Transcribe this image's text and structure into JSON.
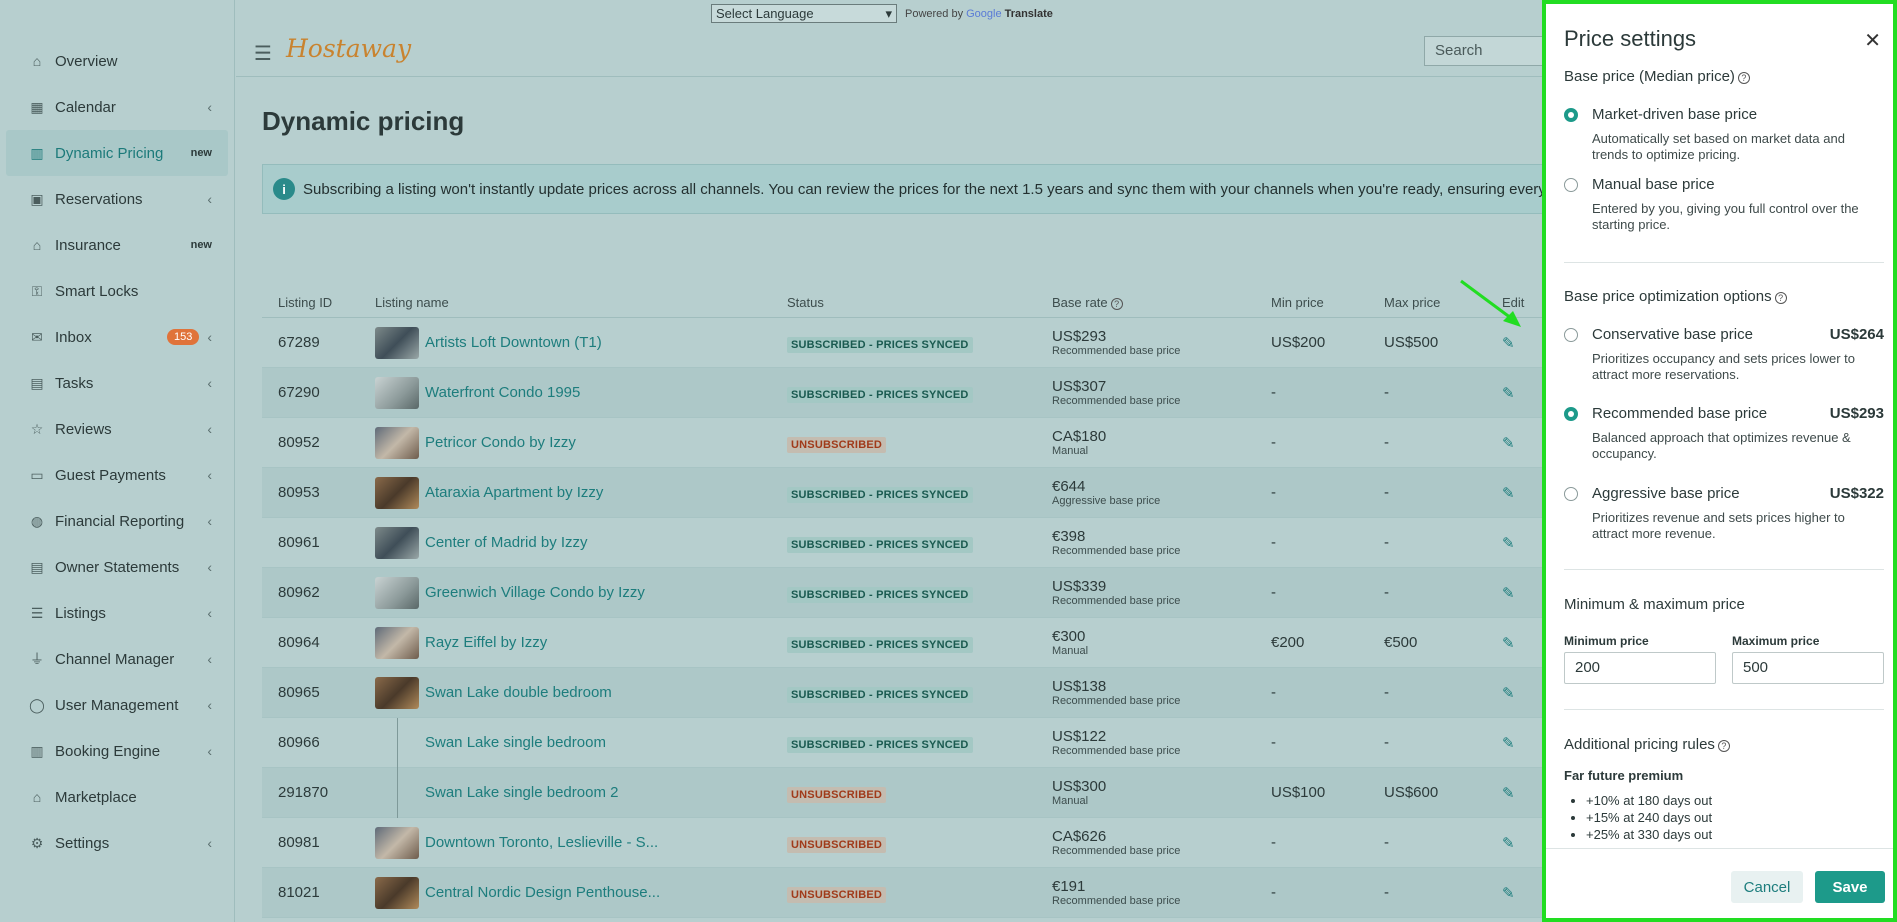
{
  "sidebar": {
    "items": [
      {
        "label": "Overview",
        "icon": "home-icon",
        "badge": "",
        "chevron": false
      },
      {
        "label": "Calendar",
        "icon": "calendar-icon",
        "badge": "",
        "chevron": true
      },
      {
        "label": "Dynamic Pricing",
        "icon": "bar-chart-icon",
        "badge": "new",
        "chevron": false
      },
      {
        "label": "Reservations",
        "icon": "calendar-check-icon",
        "badge": "",
        "chevron": true
      },
      {
        "label": "Insurance",
        "icon": "home-shield-icon",
        "badge": "new",
        "chevron": false
      },
      {
        "label": "Smart Locks",
        "icon": "key-icon",
        "badge": "",
        "chevron": false
      },
      {
        "label": "Inbox",
        "icon": "inbox-icon",
        "badge": "153",
        "chevron": true
      },
      {
        "label": "Tasks",
        "icon": "briefcase-icon",
        "badge": "",
        "chevron": true
      },
      {
        "label": "Reviews",
        "icon": "star-icon",
        "badge": "",
        "chevron": true
      },
      {
        "label": "Guest Payments",
        "icon": "wallet-icon",
        "badge": "",
        "chevron": true
      },
      {
        "label": "Financial Reporting",
        "icon": "money-icon",
        "badge": "",
        "chevron": true
      },
      {
        "label": "Owner Statements",
        "icon": "document-icon",
        "badge": "",
        "chevron": true
      },
      {
        "label": "Listings",
        "icon": "list-icon",
        "badge": "",
        "chevron": true
      },
      {
        "label": "Channel Manager",
        "icon": "plug-icon",
        "badge": "",
        "chevron": true
      },
      {
        "label": "User Management",
        "icon": "user-icon",
        "badge": "",
        "chevron": true
      },
      {
        "label": "Booking Engine",
        "icon": "layout-icon",
        "badge": "",
        "chevron": true
      },
      {
        "label": "Marketplace",
        "icon": "store-icon",
        "badge": "",
        "chevron": false
      },
      {
        "label": "Settings",
        "icon": "gear-icon",
        "badge": "",
        "chevron": true
      }
    ]
  },
  "topbar": {
    "language_select": "Select Language",
    "powered_by": "Powered by",
    "google": "Google",
    "translate": "Translate",
    "logo": "Hostaway",
    "search_placeholder": "Search"
  },
  "main": {
    "title": "Dynamic pricing",
    "banner": "Subscribing a listing won't instantly update prices across all channels. You can review the prices for the next 1.5 years and sync them with your channels when you're ready, ensuring everythin",
    "columns": [
      "Listing ID",
      "Listing name",
      "Status",
      "Base rate",
      "Min price",
      "Max price",
      "Edit"
    ],
    "rows": [
      {
        "id": "67289",
        "name": "Artists Loft Downtown (T1)",
        "status": "SUBSCRIBED - PRICES SYNCED",
        "base": "US$293",
        "base_sub": "Recommended base price",
        "min": "US$200",
        "max": "US$500"
      },
      {
        "id": "67290",
        "name": "Waterfront Condo 1995",
        "status": "SUBSCRIBED - PRICES SYNCED",
        "base": "US$307",
        "base_sub": "Recommended base price",
        "min": "-",
        "max": "-"
      },
      {
        "id": "80952",
        "name": "Petricor Condo by Izzy",
        "status": "UNSUBSCRIBED",
        "base": "CA$180",
        "base_sub": "Manual",
        "min": "-",
        "max": "-"
      },
      {
        "id": "80953",
        "name": "Ataraxia Apartment by Izzy",
        "status": "SUBSCRIBED - PRICES SYNCED",
        "base": "€644",
        "base_sub": "Aggressive base price",
        "min": "-",
        "max": "-"
      },
      {
        "id": "80961",
        "name": "Center of Madrid by Izzy",
        "status": "SUBSCRIBED - PRICES SYNCED",
        "base": "€398",
        "base_sub": "Recommended base price",
        "min": "-",
        "max": "-"
      },
      {
        "id": "80962",
        "name": "Greenwich Village Condo by Izzy",
        "status": "SUBSCRIBED - PRICES SYNCED",
        "base": "US$339",
        "base_sub": "Recommended base price",
        "min": "-",
        "max": "-"
      },
      {
        "id": "80964",
        "name": "Rayz Eiffel by Izzy",
        "status": "SUBSCRIBED - PRICES SYNCED",
        "base": "€300",
        "base_sub": "Manual",
        "min": "€200",
        "max": "€500"
      },
      {
        "id": "80965",
        "name": "Swan Lake double bedroom",
        "status": "SUBSCRIBED - PRICES SYNCED",
        "base": "US$138",
        "base_sub": "Recommended base price",
        "min": "-",
        "max": "-"
      },
      {
        "id": "80966",
        "name": "Swan Lake single bedroom",
        "status": "SUBSCRIBED - PRICES SYNCED",
        "base": "US$122",
        "base_sub": "Recommended base price",
        "min": "-",
        "max": "-"
      },
      {
        "id": "291870",
        "name": "Swan Lake single bedroom 2",
        "status": "UNSUBSCRIBED",
        "base": "US$300",
        "base_sub": "Manual",
        "min": "US$100",
        "max": "US$600"
      },
      {
        "id": "80981",
        "name": "Downtown Toronto, Leslieville - S...",
        "status": "UNSUBSCRIBED",
        "base": "CA$626",
        "base_sub": "Recommended base price",
        "min": "-",
        "max": "-"
      },
      {
        "id": "81021",
        "name": "Central Nordic Design Penthouse...",
        "status": "UNSUBSCRIBED",
        "base": "€191",
        "base_sub": "Recommended base price",
        "min": "-",
        "max": "-"
      }
    ]
  },
  "panel": {
    "title": "Price settings",
    "base_section": "Base price (Median price)",
    "market_title": "Market-driven base price",
    "market_desc": "Automatically set based on market data and trends to optimize pricing.",
    "manual_title": "Manual base price",
    "manual_desc": "Entered by you, giving you full control over the starting price.",
    "opt_section": "Base price optimization options",
    "conservative_title": "Conservative base price",
    "conservative_price": "US$264",
    "conservative_desc": "Prioritizes occupancy and sets prices lower to attract more reservations.",
    "recommended_title": "Recommended base price",
    "recommended_price": "US$293",
    "recommended_desc": "Balanced approach that optimizes revenue & occupancy.",
    "aggressive_title": "Aggressive base price",
    "aggressive_price": "US$322",
    "aggressive_desc": "Prioritizes revenue and sets prices higher to attract more revenue.",
    "minmax_section": "Minimum & maximum price",
    "min_label": "Minimum price",
    "min_value": "200",
    "max_label": "Maximum price",
    "max_value": "500",
    "rules_section": "Additional pricing rules",
    "far_future": "Far future premium",
    "rules": [
      "+10% at 180 days out",
      "+15% at 240 days out",
      "+25% at 330 days out"
    ],
    "cancel": "Cancel",
    "save": "Save"
  },
  "colors": {
    "accent": "#1d9a8a",
    "highlight": "#22dd22",
    "badge": "#e0733a"
  }
}
